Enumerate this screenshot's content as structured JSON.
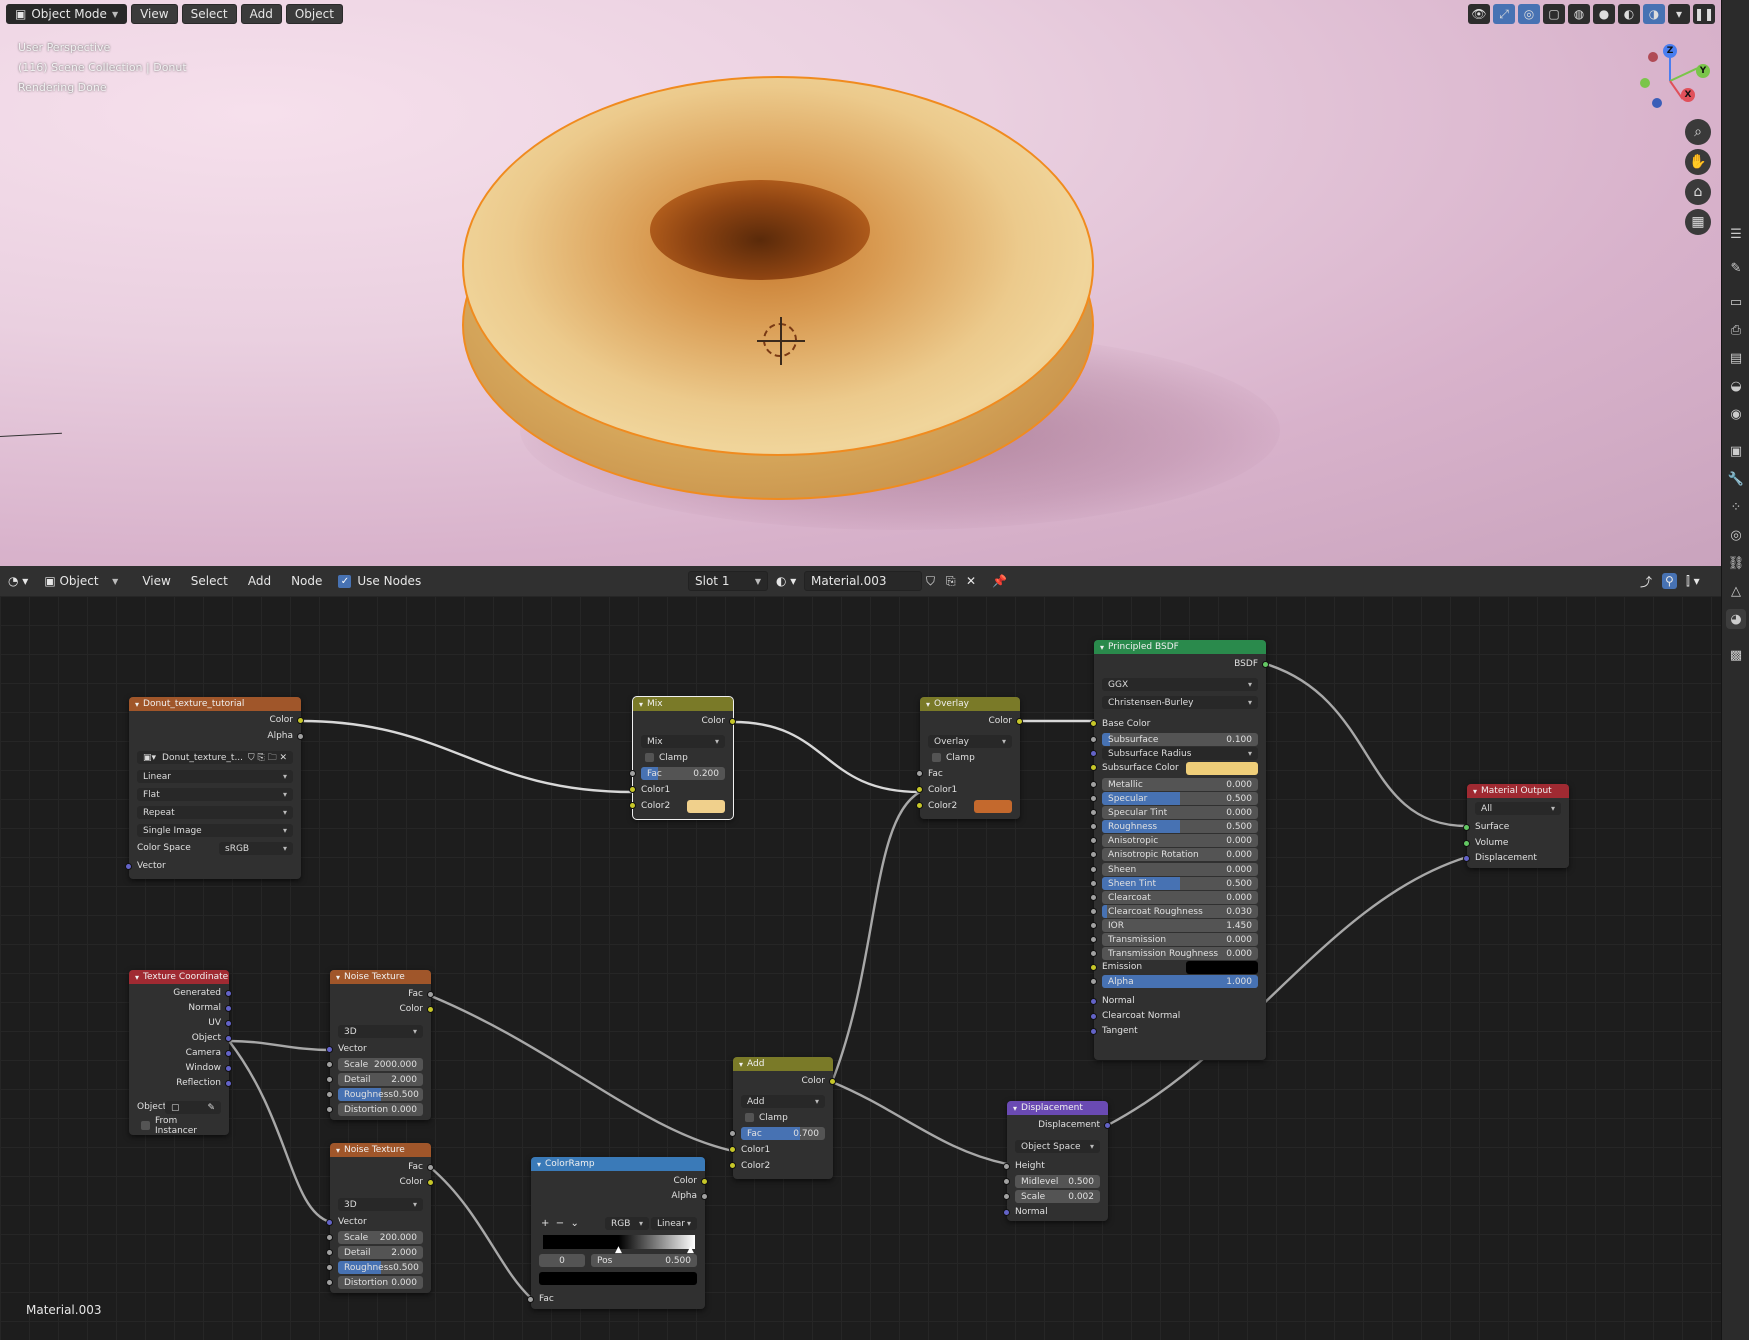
{
  "viewport": {
    "mode": "Object Mode",
    "menus": [
      "View",
      "Select",
      "Add",
      "Object"
    ],
    "info_lines": [
      "User Perspective",
      "(116) Scene Collection | Donut",
      "Rendering Done"
    ],
    "gizmo": {
      "z": "Z",
      "y": "Y",
      "x": "X"
    }
  },
  "node_editor": {
    "editor_type": "Object",
    "menus": [
      "View",
      "Select",
      "Add",
      "Node"
    ],
    "use_nodes_label": "Use Nodes",
    "slot": "Slot 1",
    "material": "Material.003",
    "status": "Material.003"
  },
  "nodes": {
    "image": {
      "title": "Donut_texture_tutorial",
      "out_color": "Color",
      "out_alpha": "Alpha",
      "image_name": "Donut_texture_t...",
      "interp": "Linear",
      "proj": "Flat",
      "ext": "Repeat",
      "source": "Single Image",
      "cs_label": "Color Space",
      "cs_value": "sRGB",
      "in_vector": "Vector"
    },
    "mix": {
      "title": "Mix",
      "out": "Color",
      "blend": "Mix",
      "clamp": "Clamp",
      "fac_label": "Fac",
      "fac": "0.200",
      "color1": "Color1",
      "color2": "Color2",
      "color2_hex": "#f0d08c"
    },
    "overlay": {
      "title": "Overlay",
      "out": "Color",
      "blend": "Overlay",
      "clamp": "Clamp",
      "fac_label": "Fac",
      "color1": "Color1",
      "color2": "Color2",
      "color2_hex": "#c4692d"
    },
    "bsdf": {
      "title": "Principled BSDF",
      "out": "BSDF",
      "dist": "GGX",
      "sss_method": "Christensen-Burley",
      "base_color": "Base Color",
      "sss_radius": "Subsurface Radius",
      "sss_color": "Subsurface Color",
      "sss_color_hex": "#f0cf7a",
      "params": [
        {
          "label": "Subsurface",
          "value": "0.100",
          "fill": 0.05
        },
        {
          "label": "Metallic",
          "value": "0.000",
          "fill": 0
        },
        {
          "label": "Specular",
          "value": "0.500",
          "fill": 0.5
        },
        {
          "label": "Specular Tint",
          "value": "0.000",
          "fill": 0
        },
        {
          "label": "Roughness",
          "value": "0.500",
          "fill": 0.5
        },
        {
          "label": "Anisotropic",
          "value": "0.000",
          "fill": 0
        },
        {
          "label": "Anisotropic Rotation",
          "value": "0.000",
          "fill": 0
        },
        {
          "label": "Sheen",
          "value": "0.000",
          "fill": 0
        },
        {
          "label": "Sheen Tint",
          "value": "0.500",
          "fill": 0.5
        },
        {
          "label": "Clearcoat",
          "value": "0.000",
          "fill": 0
        },
        {
          "label": "Clearcoat Roughness",
          "value": "0.030",
          "fill": 0.03
        },
        {
          "label": "IOR",
          "value": "1.450",
          "fill": 0
        },
        {
          "label": "Transmission",
          "value": "0.000",
          "fill": 0
        },
        {
          "label": "Transmission Roughness",
          "value": "0.000",
          "fill": 0
        }
      ],
      "emission": "Emission",
      "alpha_label": "Alpha",
      "alpha": "1.000",
      "normal": "Normal",
      "cc_normal": "Clearcoat Normal",
      "tangent": "Tangent"
    },
    "output": {
      "title": "Material Output",
      "target": "All",
      "surface": "Surface",
      "volume": "Volume",
      "displacement": "Displacement"
    },
    "texcoord": {
      "title": "Texture Coordinate",
      "outs": [
        "Generated",
        "Normal",
        "UV",
        "Object",
        "Camera",
        "Window",
        "Reflection"
      ],
      "object_label": "Object:",
      "from_instancer": "From Instancer"
    },
    "noise1": {
      "title": "Noise Texture",
      "fac": "Fac",
      "color": "Color",
      "dim": "3D",
      "vector": "Vector",
      "params": [
        {
          "label": "Scale",
          "value": "2000.000",
          "fill": 0
        },
        {
          "label": "Detail",
          "value": "2.000",
          "fill": 0
        },
        {
          "label": "Roughness",
          "value": "0.500",
          "fill": 0.5
        },
        {
          "label": "Distortion",
          "value": "0.000",
          "fill": 0
        }
      ]
    },
    "noise2": {
      "title": "Noise Texture",
      "fac": "Fac",
      "color": "Color",
      "dim": "3D",
      "vector": "Vector",
      "params": [
        {
          "label": "Scale",
          "value": "200.000",
          "fill": 0
        },
        {
          "label": "Detail",
          "value": "2.000",
          "fill": 0
        },
        {
          "label": "Roughness",
          "value": "0.500",
          "fill": 0.5
        },
        {
          "label": "Distortion",
          "value": "0.000",
          "fill": 0
        }
      ]
    },
    "ramp": {
      "title": "ColorRamp",
      "out_color": "Color",
      "out_alpha": "Alpha",
      "mode": "RGB",
      "interp": "Linear",
      "index": "0",
      "pos_label": "Pos",
      "pos": "0.500",
      "fac": "Fac"
    },
    "add": {
      "title": "Add",
      "out": "Color",
      "blend": "Add",
      "clamp": "Clamp",
      "fac_label": "Fac",
      "fac": "0.700",
      "fac_fill": 0.7,
      "color1": "Color1",
      "color2": "Color2"
    },
    "disp": {
      "title": "Displacement",
      "out": "Displacement",
      "space": "Object Space",
      "height": "Height",
      "midlevel_label": "Midlevel",
      "midlevel": "0.500",
      "scale_label": "Scale",
      "scale": "0.002",
      "normal": "Normal"
    }
  },
  "colors": {
    "accent": "#4772b3",
    "selection": "#f08b1f",
    "mix_header": "#7a7a28",
    "texture_header": "#a0562a",
    "shader_header": "#2a8a4c",
    "output_header": "#a02a32",
    "vector_header": "#6a4ab3",
    "converter_header": "#3a7ab8"
  }
}
